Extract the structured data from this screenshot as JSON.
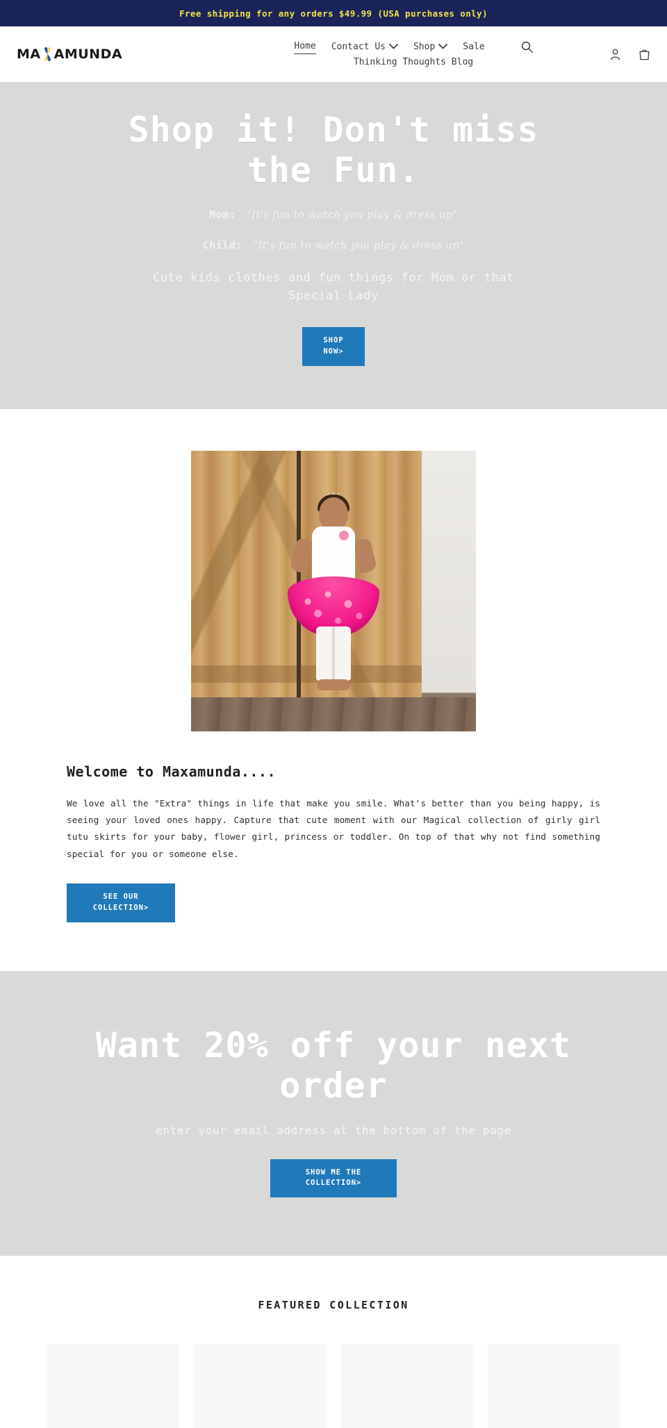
{
  "announcement": {
    "text": "Free shipping for any orders $49.99 (USA purchases only)",
    "bg_color": "#1b2458",
    "text_color": "#f2e34a"
  },
  "header": {
    "logo_left": "MA",
    "logo_right": "AMUNDA",
    "logo_mark": "butterfly-x-icon",
    "nav_row_1": [
      {
        "label": "Home",
        "has_caret": false,
        "active": true
      },
      {
        "label": "Contact Us",
        "has_caret": true,
        "active": false
      },
      {
        "label": "Shop",
        "has_caret": true,
        "active": false
      },
      {
        "label": "Sale",
        "has_caret": false,
        "active": false
      }
    ],
    "nav_row_2": [
      {
        "label": "Thinking Thoughts Blog",
        "has_caret": false,
        "active": false
      }
    ],
    "search_icon": "search-icon",
    "account_icon": "account-person-icon",
    "cart_icon": "shopping-bag-icon"
  },
  "hero": {
    "heading": "Shop it! Don't miss the Fun.",
    "quote_mom_label": "Mom:",
    "quote_mom_text": "\"It's fun to watch you play & dress up\"",
    "quote_child_label": "Child:",
    "quote_child_text": "\"It's fun to watch you play & dress up\"",
    "subtext": "Cute kids clothes and fun things for Mom or that Special Lady",
    "cta_label": "SHOP NOW>",
    "bg_color": "#d9d9d8",
    "text_color": "#ffffff"
  },
  "welcome": {
    "image_alt": "toddler-girl-pink-tutu-photo",
    "heading": "Welcome to Maxamunda....",
    "body": "We love all the \"Extra\" things in life that make you smile. What's better than you being happy, is seeing your loved ones happy. Capture that cute moment with our Magical collection of girly girl tutu skirts for your baby, flower girl, princess or toddler. On top of that why not find something special for you or someone else.",
    "cta_label": "SEE OUR COLLECTION>"
  },
  "promo": {
    "heading": "Want 20% off your next order",
    "subtext": "enter your email address at the bottom of the page",
    "cta_label": "SHOW ME THE COLLECTION>",
    "bg_color": "#d9d9d8"
  },
  "featured": {
    "heading": "FEATURED COLLECTION",
    "products": [
      {
        "placeholder": ""
      },
      {
        "placeholder": ""
      },
      {
        "placeholder": ""
      },
      {
        "placeholder": ""
      }
    ]
  },
  "theme": {
    "accent_blue": "#2079b8",
    "band_gray": "#d9d9d8",
    "navy": "#1b2458",
    "yellow": "#f2e34a"
  }
}
